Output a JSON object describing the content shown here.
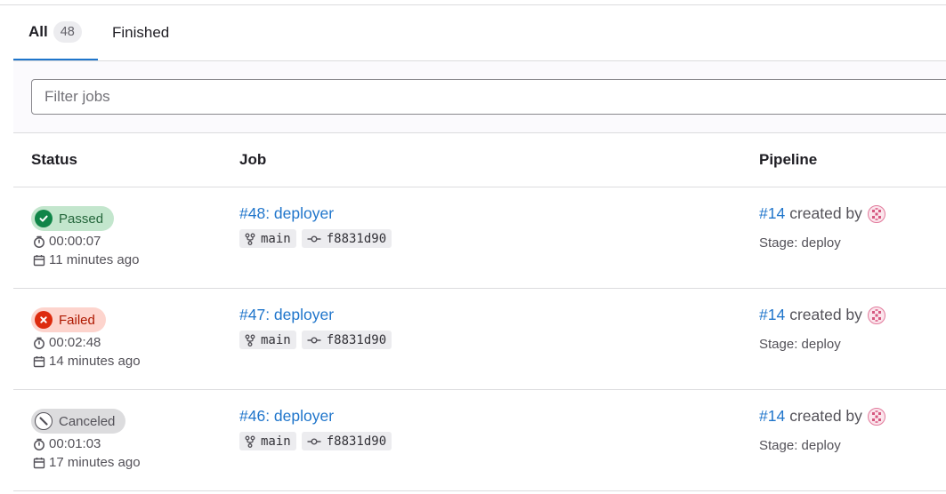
{
  "tabs": [
    {
      "label": "All",
      "count": "48"
    },
    {
      "label": "Finished"
    }
  ],
  "filter": {
    "placeholder": "Filter jobs"
  },
  "columns": {
    "status": "Status",
    "job": "Job",
    "pipeline": "Pipeline"
  },
  "jobs": [
    {
      "status": "Passed",
      "duration": "00:00:07",
      "finished": "11 minutes ago",
      "job": "#48: deployer",
      "ref": "main",
      "commit": "f8831d90",
      "pipeline": "#14",
      "created_by": "created by",
      "stage": "Stage: deploy"
    },
    {
      "status": "Failed",
      "duration": "00:02:48",
      "finished": "14 minutes ago",
      "job": "#47: deployer",
      "ref": "main",
      "commit": "f8831d90",
      "pipeline": "#14",
      "created_by": "created by",
      "stage": "Stage: deploy"
    },
    {
      "status": "Canceled",
      "duration": "00:01:03",
      "finished": "17 minutes ago",
      "job": "#46: deployer",
      "ref": "main",
      "commit": "f8831d90",
      "pipeline": "#14",
      "created_by": "created by",
      "stage": "Stage: deploy"
    }
  ],
  "icons": {
    "passed": "check-circle-icon",
    "failed": "x-circle-icon",
    "canceled": "canceled-circle-icon",
    "duration": "timer-icon",
    "finished": "calendar-icon",
    "ref": "branch-icon",
    "commit": "commit-icon",
    "user": "avatar"
  },
  "colors": {
    "link": "#1f75cb",
    "passed": "#108548",
    "failed": "#dd2b0e",
    "canceled": "#535158",
    "tab_active": "#1f75cb"
  }
}
